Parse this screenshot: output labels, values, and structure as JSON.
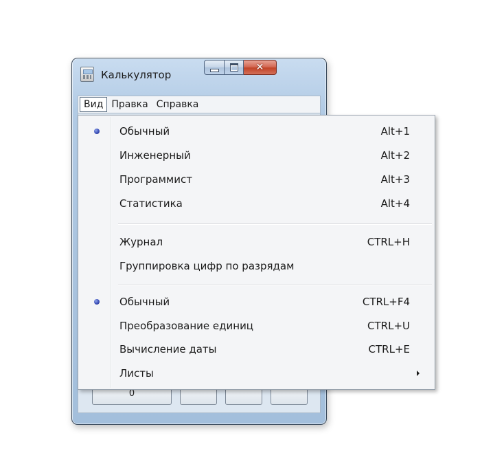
{
  "window": {
    "title": "Калькулятор",
    "close_glyph": "✕"
  },
  "menubar": {
    "items": [
      "Вид",
      "Правка",
      "Справка"
    ]
  },
  "client": {
    "visible_button_label": "0"
  },
  "dropdown": {
    "items": [
      {
        "label": "Обычный",
        "shortcut": "Alt+1",
        "checked": true
      },
      {
        "label": "Инженерный",
        "shortcut": "Alt+2",
        "checked": false
      },
      {
        "label": "Программист",
        "shortcut": "Alt+3",
        "checked": false
      },
      {
        "label": "Статистика",
        "shortcut": "Alt+4",
        "checked": false
      },
      {
        "label": "Журнал",
        "shortcut": "CTRL+H",
        "checked": false
      },
      {
        "label": "Группировка цифр по разрядам",
        "shortcut": "",
        "checked": false
      },
      {
        "label": "Обычный",
        "shortcut": "CTRL+F4",
        "checked": true
      },
      {
        "label": "Преобразование единиц",
        "shortcut": "CTRL+U",
        "checked": false
      },
      {
        "label": "Вычисление даты",
        "shortcut": "CTRL+E",
        "checked": false
      },
      {
        "label": "Листы",
        "shortcut": "",
        "checked": false,
        "submenu": true
      }
    ]
  },
  "colors": {
    "frame": "#a9c3de",
    "menu_bg": "#f4f5f7",
    "close_button": "#c24428",
    "bullet": "#3b4fb8"
  }
}
